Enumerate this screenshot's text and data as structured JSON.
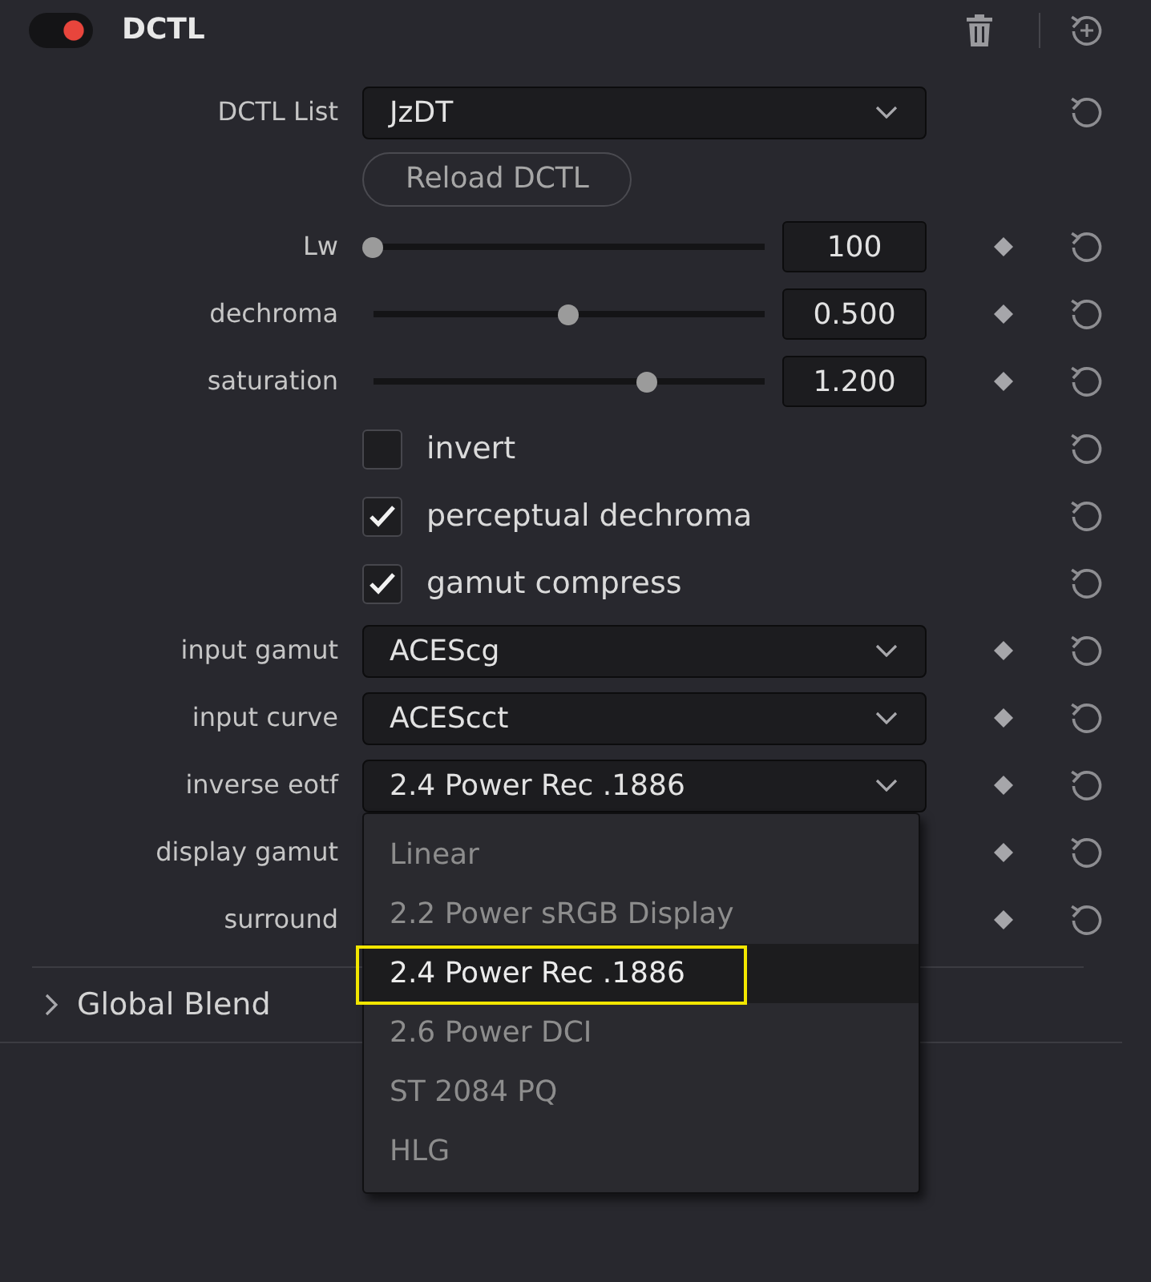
{
  "effect": {
    "title": "DCTL",
    "enabled": true
  },
  "params": [
    {
      "kind": "dropdown",
      "label": "DCTL List",
      "value": "JzDT",
      "keyframe_button": false
    },
    {
      "kind": "button",
      "label": "Reload DCTL"
    },
    {
      "kind": "slider",
      "label": "Lw",
      "level": 0,
      "value": "100",
      "keyframe_button": true
    },
    {
      "kind": "slider",
      "label": "dechroma",
      "level": 0.5,
      "value": "0.500",
      "keyframe_button": true
    },
    {
      "kind": "slider",
      "label": "saturation",
      "level": 0.7,
      "value": "1.200",
      "keyframe_button": true
    },
    {
      "kind": "checkbox",
      "label": "invert",
      "checked": false,
      "keyframe_button": false
    },
    {
      "kind": "checkbox",
      "label": "perceptual dechroma",
      "checked": true,
      "keyframe_button": false
    },
    {
      "kind": "checkbox",
      "label": "gamut compress",
      "checked": true,
      "keyframe_button": false
    },
    {
      "kind": "dropdown",
      "label": "input gamut",
      "value": "ACEScg",
      "keyframe_button": true
    },
    {
      "kind": "dropdown",
      "label": "input curve",
      "value": "ACEScct",
      "keyframe_button": true
    },
    {
      "kind": "dropdown",
      "label": "inverse eotf",
      "value": "2.4 Power Rec .1886",
      "keyframe_button": true,
      "expanded": true,
      "options": [
        {
          "label": "Linear",
          "selected": false,
          "outlined": false
        },
        {
          "label": "2.2 Power sRGB Display",
          "selected": false,
          "outlined": false
        },
        {
          "label": "2.4 Power Rec .1886",
          "selected": true,
          "outlined": true
        },
        {
          "label": "2.6 Power DCI",
          "selected": false,
          "outlined": false
        },
        {
          "label": "ST 2084 PQ",
          "selected": false,
          "outlined": false
        },
        {
          "label": "HLG",
          "selected": false,
          "outlined": false
        }
      ]
    },
    {
      "kind": "dropdown",
      "label": "display gamut",
      "keyframe_button": true
    },
    {
      "kind": "dropdown",
      "label": "surround",
      "keyframe_button": true
    }
  ],
  "sections": [
    {
      "title": "Global Blend",
      "expanded": false
    }
  ]
}
